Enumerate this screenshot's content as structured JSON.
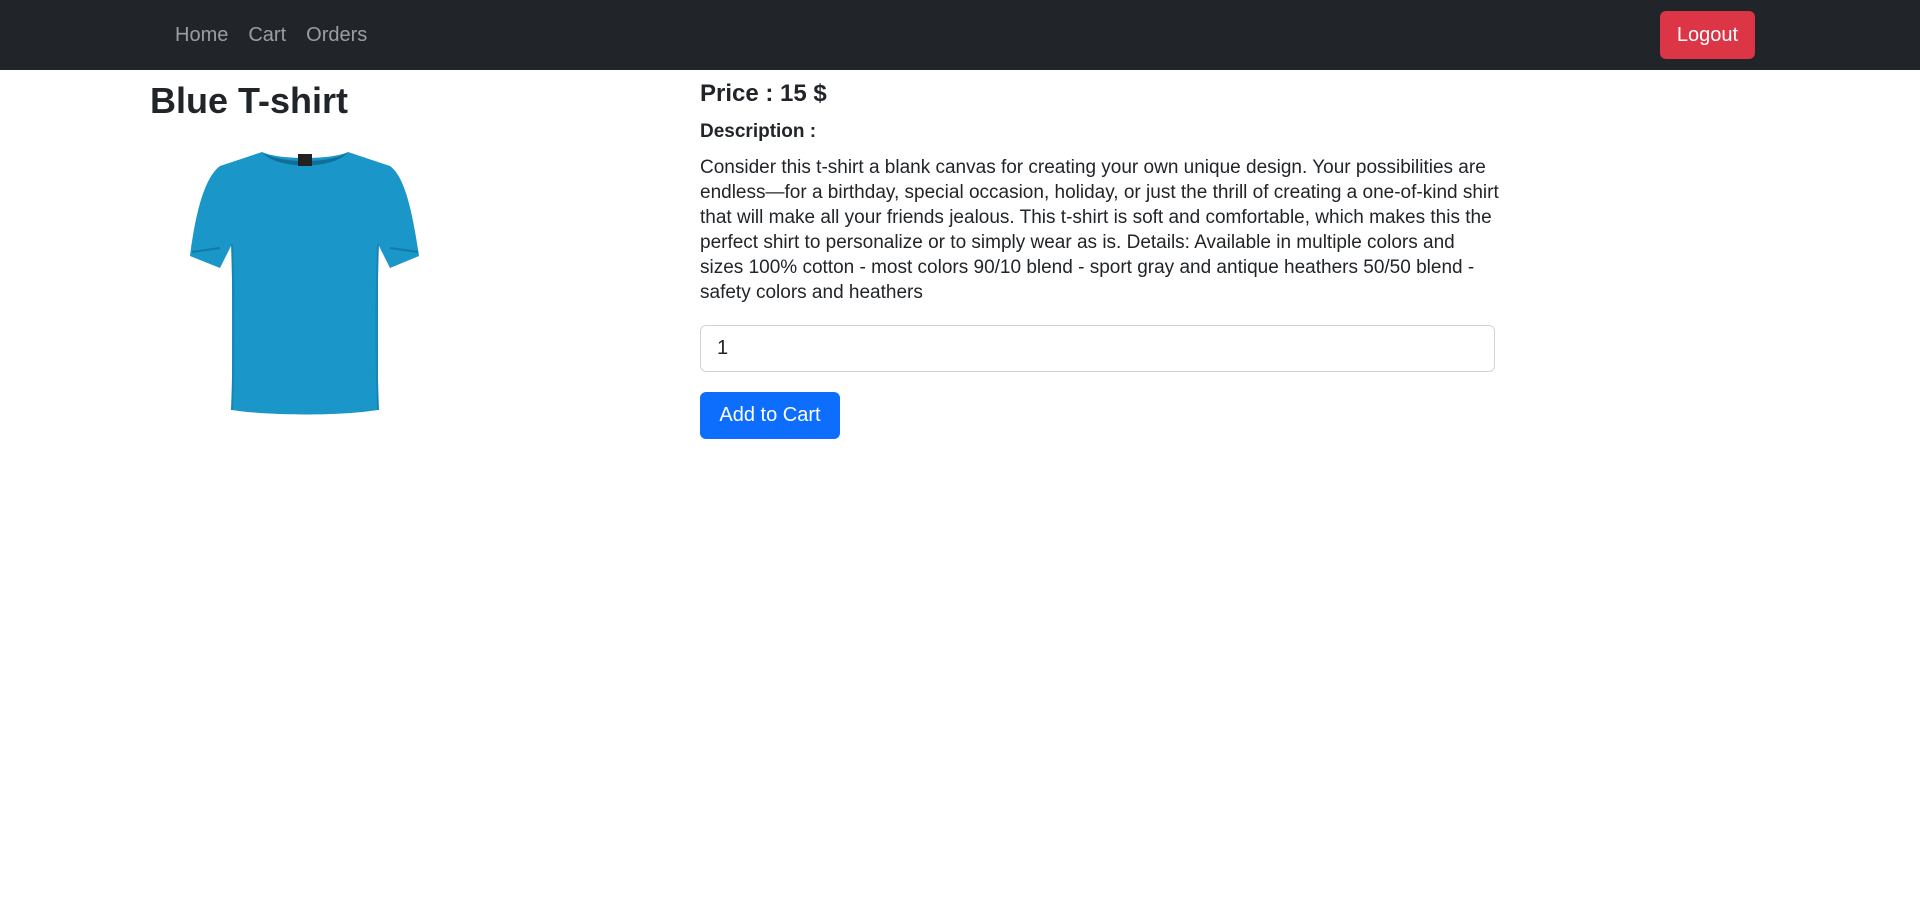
{
  "navbar": {
    "links": [
      {
        "label": "Home"
      },
      {
        "label": "Cart"
      },
      {
        "label": "Orders"
      }
    ],
    "logout_label": "Logout"
  },
  "product": {
    "title": "Blue T-shirt",
    "price": "Price : 15 $",
    "description_label": "Description :",
    "description": "Consider this t-shirt a blank canvas for creating your own unique design. Your possibilities are endless—for a birthday, special occasion, holiday, or just the thrill of creating a one-of-kind shirt that will make all your friends jealous. This t-shirt is soft and comfortable, which makes this the perfect shirt to personalize or to simply wear as is. Details: Available in multiple colors and sizes 100% cotton - most colors 90/10 blend - sport gray and antique heathers 50/50 blend - safety colors and heathers",
    "quantity": "1",
    "add_to_cart_label": "Add to Cart",
    "shirt_color": "#1a96c9"
  },
  "colors": {
    "navbar": "#212529",
    "logout": "#dc3545",
    "primary": "#0d6efd"
  }
}
